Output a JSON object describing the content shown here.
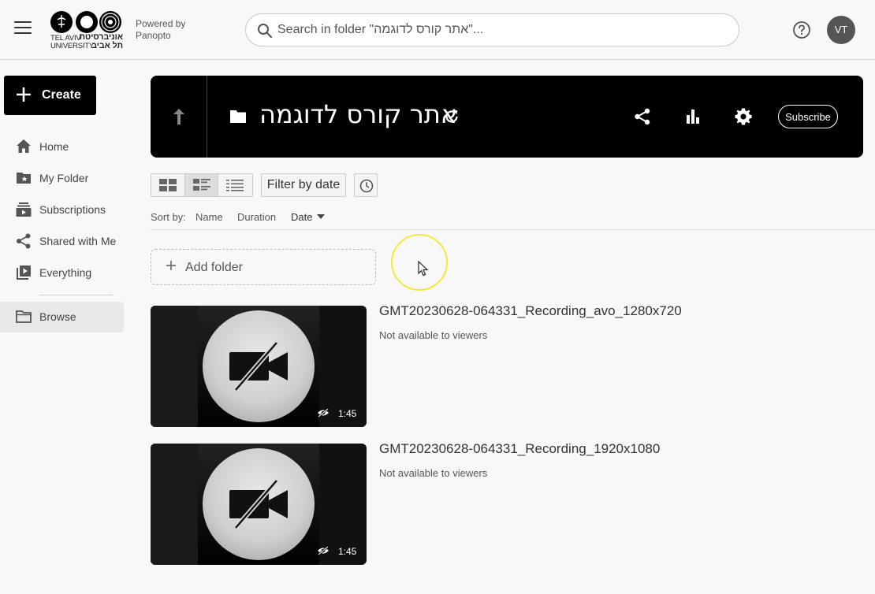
{
  "header": {
    "logo_en": "TEL AVIV\nUNIVERSITY",
    "logo_he": "אוניברסיטת\nתל אביב",
    "powered_line1": "Powered by",
    "powered_line2": "Panopto",
    "search_placeholder": "Search in folder \"אתר קורס לדוגמה\"...",
    "avatar_initials": "VT"
  },
  "sidebar": {
    "create_label": "Create",
    "items": [
      {
        "label": "Home",
        "icon": "home-icon"
      },
      {
        "label": "My Folder",
        "icon": "folder-star-icon"
      },
      {
        "label": "Subscriptions",
        "icon": "subscriptions-icon"
      },
      {
        "label": "Shared with Me",
        "icon": "share-icon"
      },
      {
        "label": "Everything",
        "icon": "video-library-icon"
      },
      {
        "label": "Browse",
        "icon": "folder-icon"
      }
    ],
    "active": "Browse"
  },
  "banner": {
    "folder_title": "אתר קורס לדוגמה",
    "subscribe_label": "Subscribe"
  },
  "toolbar": {
    "filter_label": "Filter by date",
    "sort_by_label": "Sort by:",
    "sort_name": "Name",
    "sort_duration": "Duration",
    "sort_date": "Date",
    "active_view": "detail"
  },
  "add_folder_label": "Add folder",
  "sessions": [
    {
      "title": "GMT20230628-064331_Recording_avo_1280x720",
      "status": "Not available to viewers",
      "duration": "1:45"
    },
    {
      "title": "GMT20230628-064331_Recording_1920x1080",
      "status": "Not available to viewers",
      "duration": "1:45"
    }
  ],
  "colors": {
    "accent_cursor": "#f3e93a",
    "banner_bg": "#000000"
  }
}
